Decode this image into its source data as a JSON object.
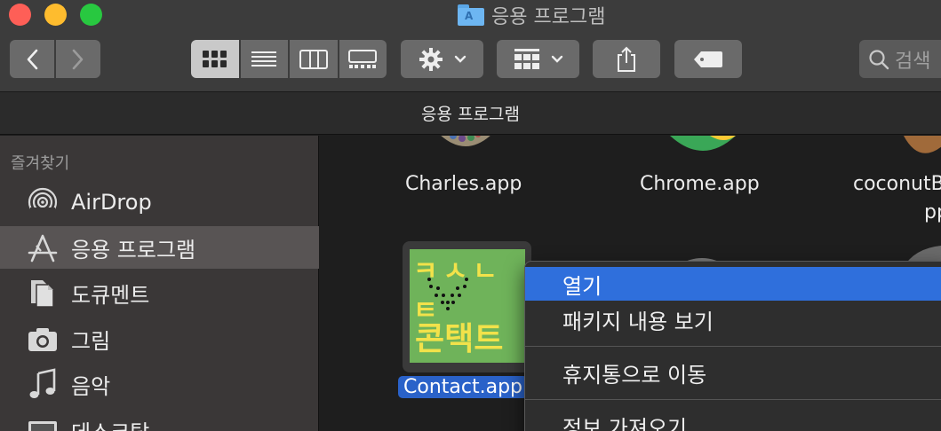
{
  "window": {
    "title": "응용 프로그램"
  },
  "toolbar": {
    "search_placeholder": "검색"
  },
  "pathbar": {
    "label": "응용 프로그램"
  },
  "sidebar": {
    "header": "즐겨찾기",
    "items": [
      {
        "label": "AirDrop",
        "icon": "airdrop-icon"
      },
      {
        "label": "응용 프로그램",
        "icon": "applications-icon"
      },
      {
        "label": "도큐멘트",
        "icon": "documents-icon"
      },
      {
        "label": "그림",
        "icon": "pictures-icon"
      },
      {
        "label": "음악",
        "icon": "music-icon"
      },
      {
        "label": "데스크탑",
        "icon": "desktop-icon"
      }
    ]
  },
  "files": [
    {
      "label": "Charles.app"
    },
    {
      "label": "Chrome.app"
    },
    {
      "label": "coconutB"
    },
    {
      "label": "Contact.app"
    }
  ],
  "contact_icon": {
    "top_text": "ㅋㅅㄴㅌ",
    "bottom_text": "콘택트"
  },
  "context_menu": {
    "items": [
      {
        "label": "열기"
      },
      {
        "label": "패키지 내용 보기"
      },
      {
        "label": "휴지통으로 이동"
      },
      {
        "label": "정보 가져오기"
      }
    ]
  },
  "colors": {
    "accent": "#2f6fdc",
    "selection": "#2a62c9"
  }
}
